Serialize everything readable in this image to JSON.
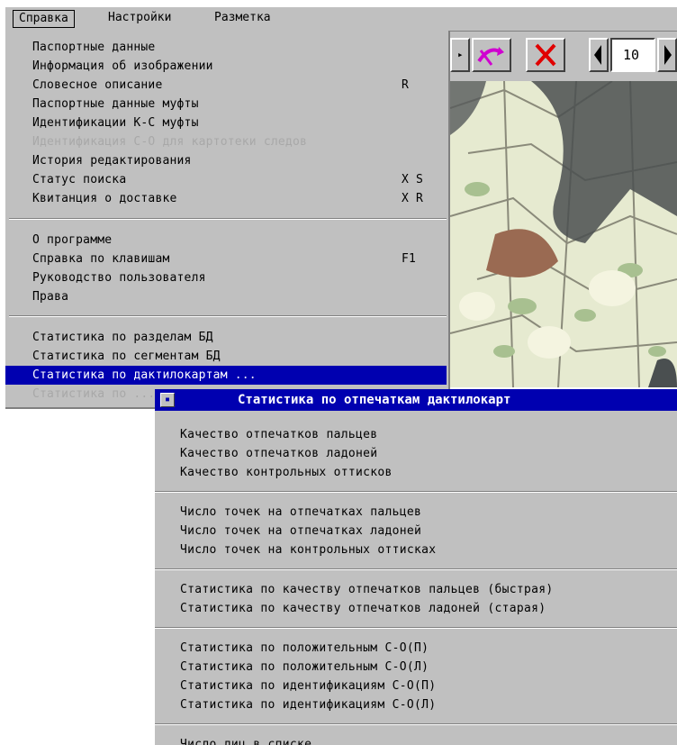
{
  "menubar": {
    "items": [
      "Справка",
      "Настройки",
      "Разметка"
    ]
  },
  "toolbar": {
    "page_number": "10",
    "icons": [
      "arrow-icon",
      "magenta-swap-icon",
      "close-icon",
      "left-triangle-icon",
      "right-triangle-icon"
    ]
  },
  "help_menu": {
    "group1": [
      {
        "label": "Паспортные данные",
        "shortcut": ""
      },
      {
        "label": "Информация об изображении",
        "shortcut": ""
      },
      {
        "label": "Словесное описание",
        "shortcut": "R"
      },
      {
        "label": "Паспортные данные муфты",
        "shortcut": ""
      },
      {
        "label": "Идентификации К-С муфты",
        "shortcut": ""
      },
      {
        "label": "Идентификация С-О для картотеки следов",
        "shortcut": "",
        "disabled": true
      },
      {
        "label": "История редактирования",
        "shortcut": ""
      },
      {
        "label": "Статус поиска",
        "shortcut": "X S"
      },
      {
        "label": "Квитанция о доставке",
        "shortcut": "X R"
      }
    ],
    "group2": [
      {
        "label": "О программе",
        "shortcut": ""
      },
      {
        "label": "Справка по клавишам",
        "shortcut": "F1"
      },
      {
        "label": "Руководство пользователя",
        "shortcut": ""
      },
      {
        "label": "Права",
        "shortcut": ""
      }
    ],
    "group3": [
      {
        "label": "Статистика по разделам БД",
        "shortcut": ""
      },
      {
        "label": "Статистика по сегментам БД",
        "shortcut": ""
      },
      {
        "label": "Статистика по дактилокартам ...",
        "shortcut": "",
        "selected": true
      },
      {
        "label": "Статистика по ...",
        "shortcut": "",
        "disabled": true
      }
    ]
  },
  "submenu": {
    "title": "Статистика по отпечаткам дактилокарт",
    "group1": [
      "Качество отпечатков пальцев",
      "Качество отпечатков ладоней",
      "Качество контрольных оттисков"
    ],
    "group2": [
      "Число точек на отпечатках пальцев",
      "Число точек на отпечатках ладоней",
      "Число точек на контрольных оттисках"
    ],
    "group3": [
      "Статистика по качеству отпечатков пальцев (быстрая)",
      "Статистика по качеству отпечатков ладоней (старая)"
    ],
    "group4": [
      "Статистика по положительным С-О(П)",
      "Статистика по положительным С-О(Л)",
      "Статистика по идентификациям С-О(П)",
      "Статистика по идентификациям С-О(Л)"
    ],
    "group5": [
      "Число лиц в списке"
    ]
  },
  "colors": {
    "menu_bg": "#c0c0c0",
    "highlight": "#0000b0",
    "disabled_text": "#a8a8a8"
  }
}
